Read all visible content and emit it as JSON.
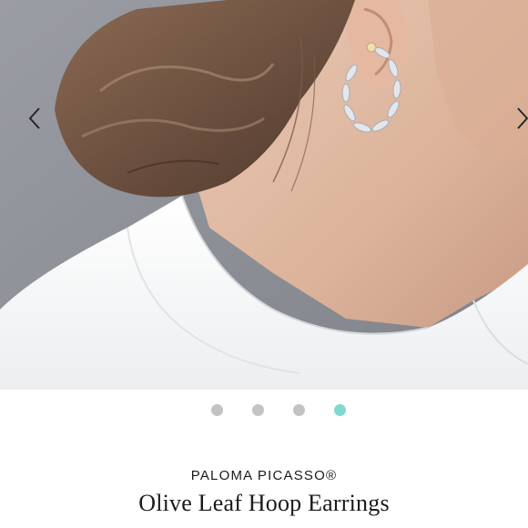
{
  "gallery": {
    "photo_alt": "Woman wearing olive leaf hoop earring",
    "prev_icon": "chevron-left-icon",
    "next_icon": "chevron-right-icon",
    "slides_total": 4,
    "active_slide": 4
  },
  "colors": {
    "dot_inactive": "#c3c3c3",
    "dot_active": "#81d8d0",
    "text": "#1a1a1a"
  },
  "product": {
    "brand": "PALOMA PICASSO®",
    "title": "Olive Leaf Hoop Earrings"
  }
}
